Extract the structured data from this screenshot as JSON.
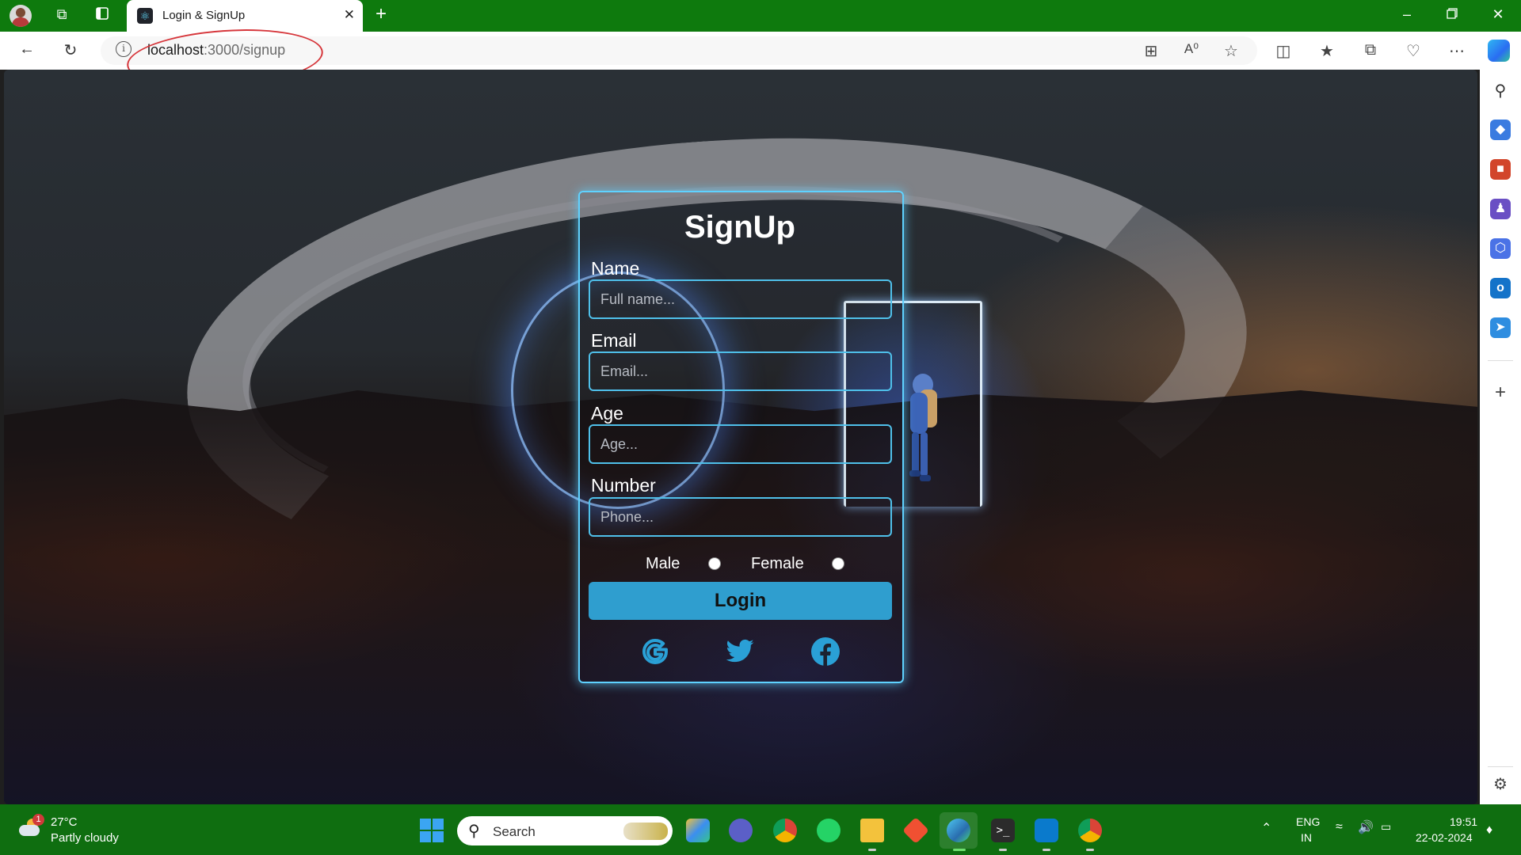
{
  "browser": {
    "tab_title": "Login & SignUp",
    "url_host": "localhost",
    "url_path": ":3000/signup"
  },
  "form": {
    "title": "SignUp",
    "fields": [
      {
        "label": "Name",
        "placeholder": "Full name..."
      },
      {
        "label": "Email",
        "placeholder": "Email..."
      },
      {
        "label": "Age",
        "placeholder": "Age..."
      },
      {
        "label": "Number",
        "placeholder": "Phone..."
      }
    ],
    "gender_options": [
      "Male",
      "Female"
    ],
    "submit_label": "Login",
    "social": [
      "google-icon",
      "twitter-icon",
      "facebook-icon"
    ],
    "accent_color": "#2f9ecf",
    "border_color": "#5fd2ff"
  },
  "taskbar": {
    "weather_temp": "27°C",
    "weather_desc": "Partly cloudy",
    "weather_badge": "1",
    "search_label": "Search",
    "lang_top": "ENG",
    "lang_bottom": "IN",
    "time": "19:51",
    "date": "22-02-2024"
  }
}
